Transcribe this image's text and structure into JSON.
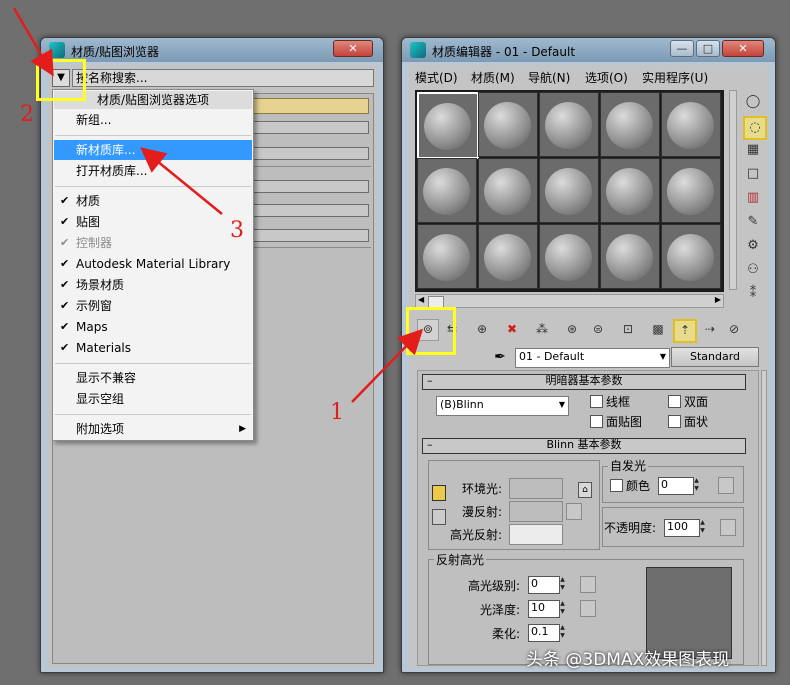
{
  "browser": {
    "title": "材质/贴图浏览器",
    "search_placeholder": "按名称搜索...",
    "close_label": "✕"
  },
  "context_menu": {
    "header": "材质/贴图浏览器选项",
    "items": [
      {
        "label": "新组...",
        "checked": false
      },
      {
        "label": "新材质库...",
        "checked": false,
        "selected": true
      },
      {
        "label": "打开材质库...",
        "checked": false
      },
      {
        "label": "材质",
        "checked": true
      },
      {
        "label": "贴图",
        "checked": true
      },
      {
        "label": "控制器",
        "checked": true,
        "disabled": true
      },
      {
        "label": "Autodesk Material Library",
        "checked": true
      },
      {
        "label": "场景材质",
        "checked": true
      },
      {
        "label": "示例窗",
        "checked": true
      },
      {
        "label": "Maps",
        "checked": true
      },
      {
        "label": "Materials",
        "checked": true
      },
      {
        "label": "显示不兼容",
        "checked": false
      },
      {
        "label": "显示空组",
        "checked": false
      },
      {
        "label": "附加选项",
        "checked": false,
        "submenu": true
      }
    ]
  },
  "editor": {
    "title": "材质编辑器 - 01 - Default",
    "menu": [
      "模式(D)",
      "材质(M)",
      "导航(N)",
      "选项(O)",
      "实用程序(U)"
    ],
    "material_name": "01 - Default",
    "material_type": "Standard",
    "shader_rollout": {
      "title": "明暗器基本参数",
      "shader": "(B)Blinn",
      "options": [
        "线框",
        "双面",
        "面贴图",
        "面状"
      ]
    },
    "blinn_rollout": {
      "title": "Blinn 基本参数",
      "self_illum_group": "自发光",
      "color_label": "颜色",
      "color_value": "0",
      "ambient": "环境光:",
      "diffuse": "漫反射:",
      "specular": "高光反射:",
      "opacity_label": "不透明度:",
      "opacity_value": "100",
      "spec_group": "反射高光",
      "spec_level_label": "高光级别:",
      "spec_level": "0",
      "gloss_label": "光泽度:",
      "gloss": "10",
      "soften_label": "柔化:",
      "soften": "0.1"
    }
  },
  "annotations": {
    "marker_1": "1",
    "marker_2": "2",
    "marker_3": "3",
    "color": "#e31c1c",
    "highlight_color": "#ffff20"
  },
  "watermark": "头条 @3DMAX效果图表现"
}
